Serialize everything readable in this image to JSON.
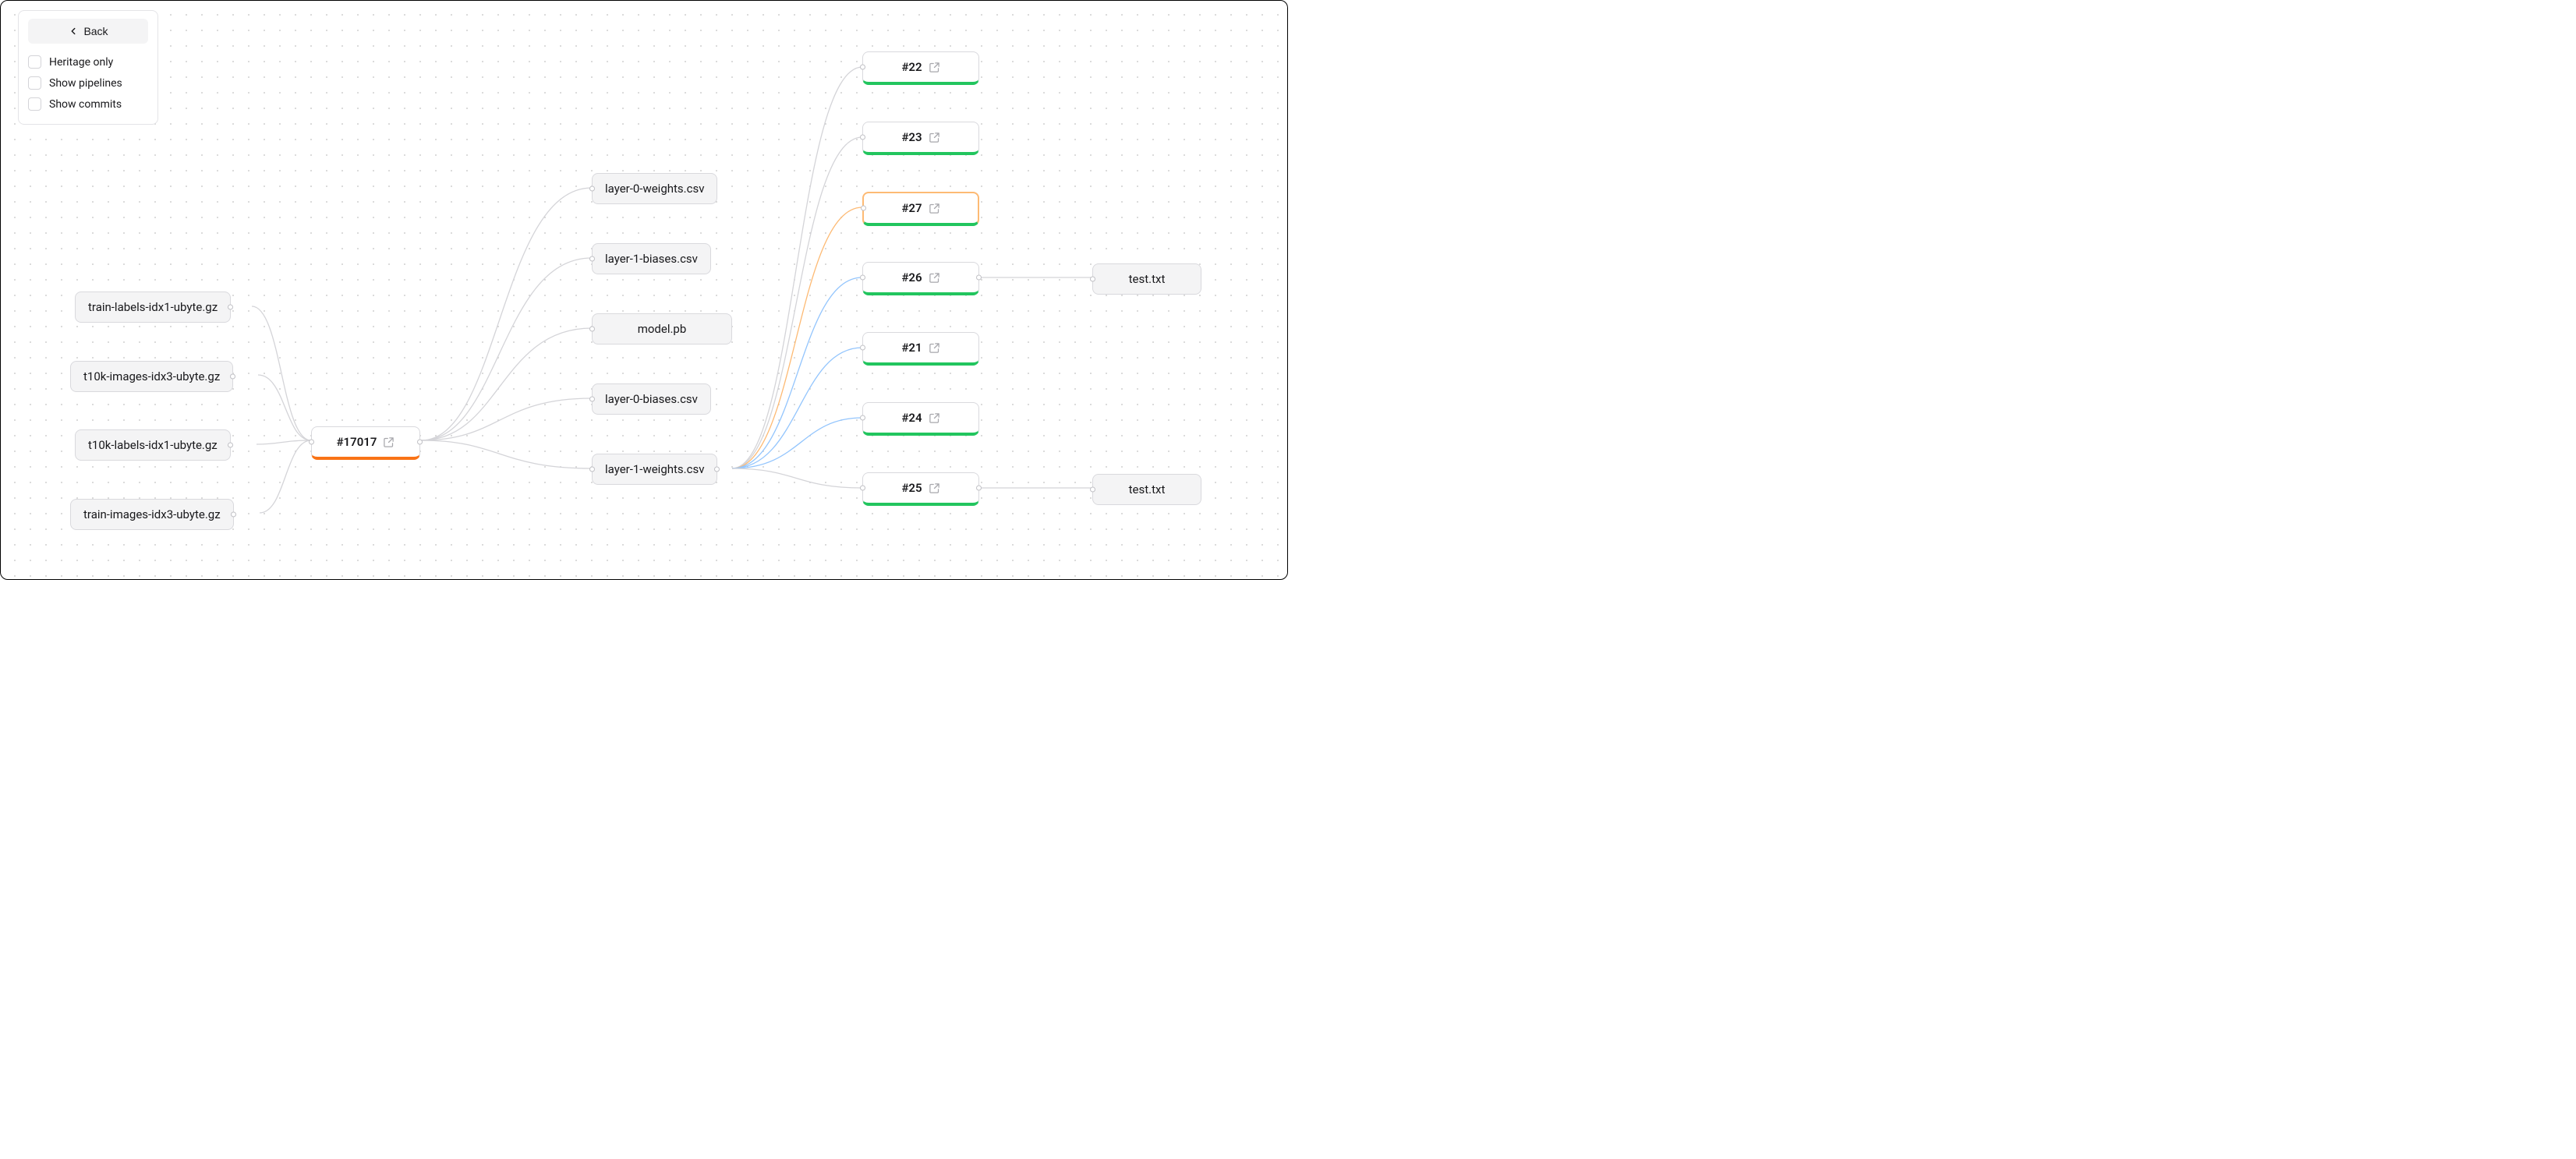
{
  "panel": {
    "back": "Back",
    "heritage": "Heritage only",
    "pipelines": "Show pipelines",
    "commits": "Show commits"
  },
  "nodes": {
    "inA": "train-labels-idx1-ubyte.gz",
    "inB": "t10k-images-idx3-ubyte.gz",
    "inC": "t10k-labels-idx1-ubyte.gz",
    "inD": "train-images-idx3-ubyte.gz",
    "hub": "#17017",
    "mA": "layer-0-weights.csv",
    "mB": "layer-1-biases.csv",
    "mC": "model.pb",
    "mD": "layer-0-biases.csv",
    "mE": "layer-1-weights.csv",
    "j22": "#22",
    "j23": "#23",
    "j27": "#27",
    "j26": "#26",
    "j21": "#21",
    "j24": "#24",
    "j25": "#25",
    "oA": "test.txt",
    "oB": "test.txt"
  },
  "colors": {
    "accent_orange": "#f97316",
    "accent_green": "#22c55e",
    "highlight_orange": "#fdba74",
    "highlight_blue": "#93c5fd"
  }
}
